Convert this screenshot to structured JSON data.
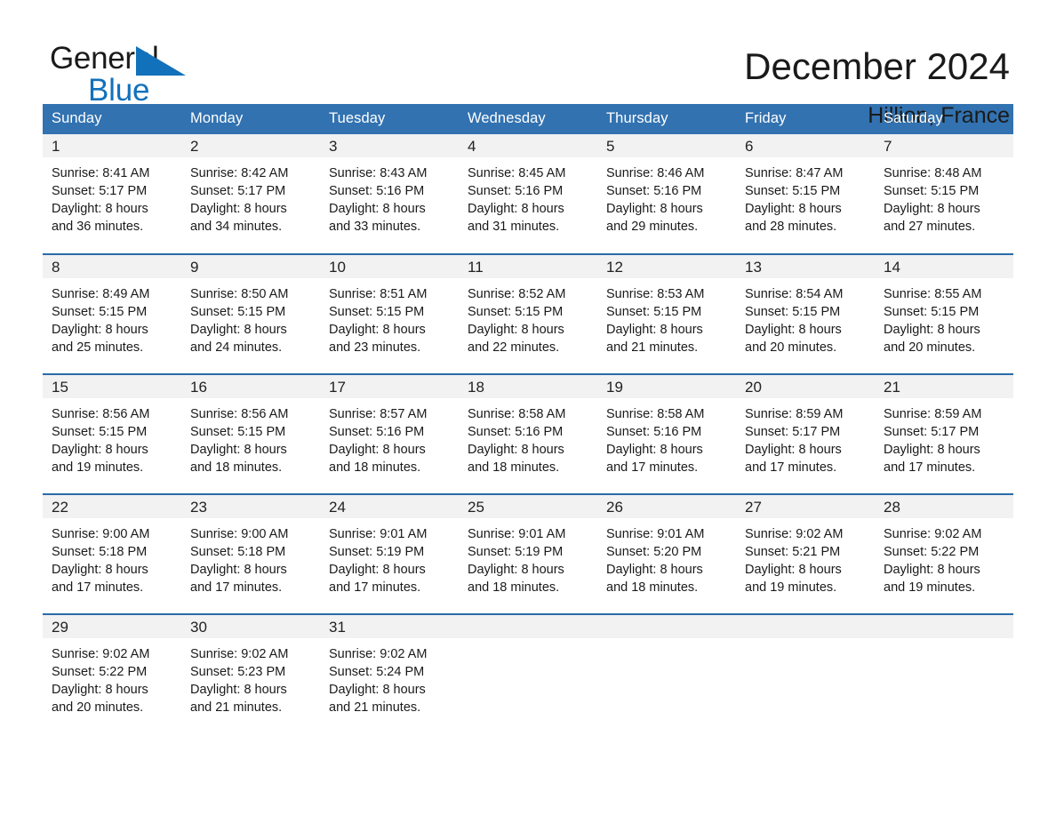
{
  "brand": {
    "name_part1": "General",
    "name_part2": "Blue",
    "triangle_color": "#1171bb",
    "text_color": "#1a1a1a"
  },
  "header": {
    "month_title": "December 2024",
    "location": "Hillion, France"
  },
  "theme": {
    "header_blue": "#3272b0",
    "row_divider_blue": "#2a6ba8",
    "daynum_band": "#f2f2f2",
    "background": "#ffffff"
  },
  "weekdays": [
    "Sunday",
    "Monday",
    "Tuesday",
    "Wednesday",
    "Thursday",
    "Friday",
    "Saturday"
  ],
  "weeks": [
    [
      {
        "day": "1",
        "sunrise": "Sunrise: 8:41 AM",
        "sunset": "Sunset: 5:17 PM",
        "daylight1": "Daylight: 8 hours",
        "daylight2": "and 36 minutes."
      },
      {
        "day": "2",
        "sunrise": "Sunrise: 8:42 AM",
        "sunset": "Sunset: 5:17 PM",
        "daylight1": "Daylight: 8 hours",
        "daylight2": "and 34 minutes."
      },
      {
        "day": "3",
        "sunrise": "Sunrise: 8:43 AM",
        "sunset": "Sunset: 5:16 PM",
        "daylight1": "Daylight: 8 hours",
        "daylight2": "and 33 minutes."
      },
      {
        "day": "4",
        "sunrise": "Sunrise: 8:45 AM",
        "sunset": "Sunset: 5:16 PM",
        "daylight1": "Daylight: 8 hours",
        "daylight2": "and 31 minutes."
      },
      {
        "day": "5",
        "sunrise": "Sunrise: 8:46 AM",
        "sunset": "Sunset: 5:16 PM",
        "daylight1": "Daylight: 8 hours",
        "daylight2": "and 29 minutes."
      },
      {
        "day": "6",
        "sunrise": "Sunrise: 8:47 AM",
        "sunset": "Sunset: 5:15 PM",
        "daylight1": "Daylight: 8 hours",
        "daylight2": "and 28 minutes."
      },
      {
        "day": "7",
        "sunrise": "Sunrise: 8:48 AM",
        "sunset": "Sunset: 5:15 PM",
        "daylight1": "Daylight: 8 hours",
        "daylight2": "and 27 minutes."
      }
    ],
    [
      {
        "day": "8",
        "sunrise": "Sunrise: 8:49 AM",
        "sunset": "Sunset: 5:15 PM",
        "daylight1": "Daylight: 8 hours",
        "daylight2": "and 25 minutes."
      },
      {
        "day": "9",
        "sunrise": "Sunrise: 8:50 AM",
        "sunset": "Sunset: 5:15 PM",
        "daylight1": "Daylight: 8 hours",
        "daylight2": "and 24 minutes."
      },
      {
        "day": "10",
        "sunrise": "Sunrise: 8:51 AM",
        "sunset": "Sunset: 5:15 PM",
        "daylight1": "Daylight: 8 hours",
        "daylight2": "and 23 minutes."
      },
      {
        "day": "11",
        "sunrise": "Sunrise: 8:52 AM",
        "sunset": "Sunset: 5:15 PM",
        "daylight1": "Daylight: 8 hours",
        "daylight2": "and 22 minutes."
      },
      {
        "day": "12",
        "sunrise": "Sunrise: 8:53 AM",
        "sunset": "Sunset: 5:15 PM",
        "daylight1": "Daylight: 8 hours",
        "daylight2": "and 21 minutes."
      },
      {
        "day": "13",
        "sunrise": "Sunrise: 8:54 AM",
        "sunset": "Sunset: 5:15 PM",
        "daylight1": "Daylight: 8 hours",
        "daylight2": "and 20 minutes."
      },
      {
        "day": "14",
        "sunrise": "Sunrise: 8:55 AM",
        "sunset": "Sunset: 5:15 PM",
        "daylight1": "Daylight: 8 hours",
        "daylight2": "and 20 minutes."
      }
    ],
    [
      {
        "day": "15",
        "sunrise": "Sunrise: 8:56 AM",
        "sunset": "Sunset: 5:15 PM",
        "daylight1": "Daylight: 8 hours",
        "daylight2": "and 19 minutes."
      },
      {
        "day": "16",
        "sunrise": "Sunrise: 8:56 AM",
        "sunset": "Sunset: 5:15 PM",
        "daylight1": "Daylight: 8 hours",
        "daylight2": "and 18 minutes."
      },
      {
        "day": "17",
        "sunrise": "Sunrise: 8:57 AM",
        "sunset": "Sunset: 5:16 PM",
        "daylight1": "Daylight: 8 hours",
        "daylight2": "and 18 minutes."
      },
      {
        "day": "18",
        "sunrise": "Sunrise: 8:58 AM",
        "sunset": "Sunset: 5:16 PM",
        "daylight1": "Daylight: 8 hours",
        "daylight2": "and 18 minutes."
      },
      {
        "day": "19",
        "sunrise": "Sunrise: 8:58 AM",
        "sunset": "Sunset: 5:16 PM",
        "daylight1": "Daylight: 8 hours",
        "daylight2": "and 17 minutes."
      },
      {
        "day": "20",
        "sunrise": "Sunrise: 8:59 AM",
        "sunset": "Sunset: 5:17 PM",
        "daylight1": "Daylight: 8 hours",
        "daylight2": "and 17 minutes."
      },
      {
        "day": "21",
        "sunrise": "Sunrise: 8:59 AM",
        "sunset": "Sunset: 5:17 PM",
        "daylight1": "Daylight: 8 hours",
        "daylight2": "and 17 minutes."
      }
    ],
    [
      {
        "day": "22",
        "sunrise": "Sunrise: 9:00 AM",
        "sunset": "Sunset: 5:18 PM",
        "daylight1": "Daylight: 8 hours",
        "daylight2": "and 17 minutes."
      },
      {
        "day": "23",
        "sunrise": "Sunrise: 9:00 AM",
        "sunset": "Sunset: 5:18 PM",
        "daylight1": "Daylight: 8 hours",
        "daylight2": "and 17 minutes."
      },
      {
        "day": "24",
        "sunrise": "Sunrise: 9:01 AM",
        "sunset": "Sunset: 5:19 PM",
        "daylight1": "Daylight: 8 hours",
        "daylight2": "and 17 minutes."
      },
      {
        "day": "25",
        "sunrise": "Sunrise: 9:01 AM",
        "sunset": "Sunset: 5:19 PM",
        "daylight1": "Daylight: 8 hours",
        "daylight2": "and 18 minutes."
      },
      {
        "day": "26",
        "sunrise": "Sunrise: 9:01 AM",
        "sunset": "Sunset: 5:20 PM",
        "daylight1": "Daylight: 8 hours",
        "daylight2": "and 18 minutes."
      },
      {
        "day": "27",
        "sunrise": "Sunrise: 9:02 AM",
        "sunset": "Sunset: 5:21 PM",
        "daylight1": "Daylight: 8 hours",
        "daylight2": "and 19 minutes."
      },
      {
        "day": "28",
        "sunrise": "Sunrise: 9:02 AM",
        "sunset": "Sunset: 5:22 PM",
        "daylight1": "Daylight: 8 hours",
        "daylight2": "and 19 minutes."
      }
    ],
    [
      {
        "day": "29",
        "sunrise": "Sunrise: 9:02 AM",
        "sunset": "Sunset: 5:22 PM",
        "daylight1": "Daylight: 8 hours",
        "daylight2": "and 20 minutes."
      },
      {
        "day": "30",
        "sunrise": "Sunrise: 9:02 AM",
        "sunset": "Sunset: 5:23 PM",
        "daylight1": "Daylight: 8 hours",
        "daylight2": "and 21 minutes."
      },
      {
        "day": "31",
        "sunrise": "Sunrise: 9:02 AM",
        "sunset": "Sunset: 5:24 PM",
        "daylight1": "Daylight: 8 hours",
        "daylight2": "and 21 minutes."
      },
      {
        "day": "",
        "sunrise": "",
        "sunset": "",
        "daylight1": "",
        "daylight2": ""
      },
      {
        "day": "",
        "sunrise": "",
        "sunset": "",
        "daylight1": "",
        "daylight2": ""
      },
      {
        "day": "",
        "sunrise": "",
        "sunset": "",
        "daylight1": "",
        "daylight2": ""
      },
      {
        "day": "",
        "sunrise": "",
        "sunset": "",
        "daylight1": "",
        "daylight2": ""
      }
    ]
  ]
}
